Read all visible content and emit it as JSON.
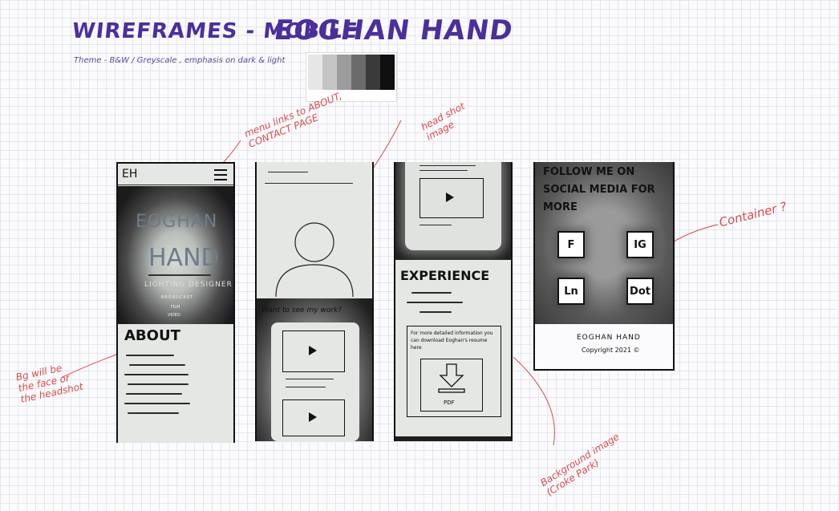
{
  "header": {
    "title": "WIREFRAMES - MOBILE",
    "name": "EOGHAN HAND",
    "theme_note": "Theme - B&W / Greyscale , emphasis on dark & light",
    "swatch_colors": [
      "#e6e6e6",
      "#c4c4c4",
      "#9c9c9c",
      "#6b6b6b",
      "#3a3a3a",
      "#0f0f0f"
    ]
  },
  "annotations": {
    "menu": "menu links to ABOUT, CONTACT PAGE",
    "head_shot": "head shot image",
    "bg_about": "Bg will be the face or the headshot",
    "background_image": "Background image (Croke Park)",
    "container": "Container ?"
  },
  "screen1": {
    "logo": "EH",
    "hero_name_1": "EOGHAN",
    "hero_name_2": "HAND",
    "hero_role": "LIGHTING DESIGNER",
    "hero_item_1": "BROADCAST",
    "hero_item_2": "FILM",
    "hero_item_3": "VIDEO",
    "about_heading": "ABOUT"
  },
  "screen2": {
    "work_prompt": "Want to see my work?"
  },
  "screen3": {
    "experience_heading": "EXPERIENCE",
    "resume_text": "For more detailed information you can download Eoghan's resume here",
    "pdf_label": "PDF"
  },
  "screen4": {
    "follow_heading": "FOLLOW ME ON SOCIAL MEDIA FOR MORE",
    "social_icons": [
      "F",
      "IG",
      "Ln",
      "Dot"
    ],
    "footer_name": "EOGHAN HAND",
    "footer_copyright": "Copyright 2021 ©"
  }
}
